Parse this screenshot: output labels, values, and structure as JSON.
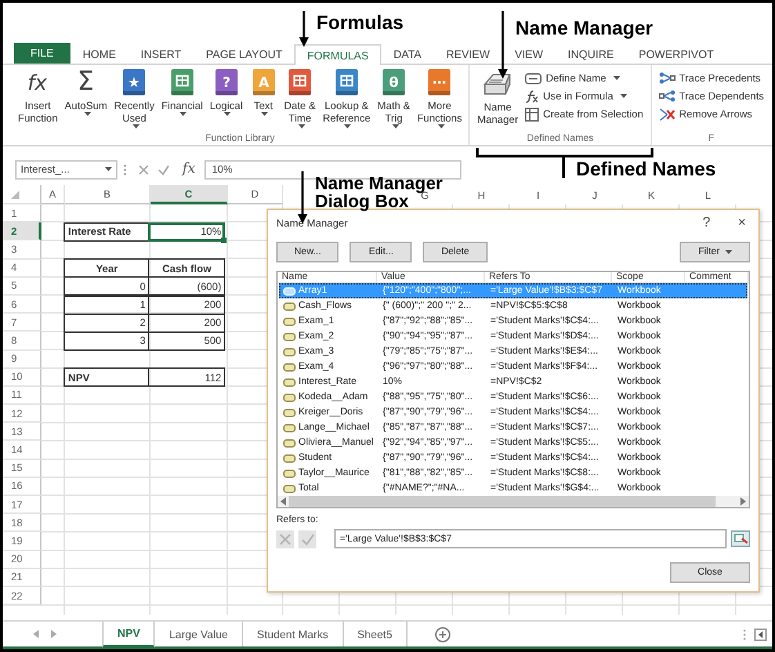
{
  "callouts": [
    {
      "lines": [
        "Formulas"
      ]
    },
    {
      "lines": [
        "Name Manager"
      ]
    },
    {
      "lines": [
        "Name Manager",
        "Dialog Box"
      ]
    },
    {
      "lines": [
        "Defined Names"
      ]
    }
  ],
  "ribbon": {
    "file_tab": "FILE",
    "tabs": [
      {
        "label": "HOME",
        "selected": false
      },
      {
        "label": "INSERT",
        "selected": false
      },
      {
        "label": "PAGE LAYOUT",
        "selected": false
      },
      {
        "label": "FORMULAS",
        "selected": true
      },
      {
        "label": "DATA",
        "selected": false
      },
      {
        "label": "REVIEW",
        "selected": false
      },
      {
        "label": "VIEW",
        "selected": false
      },
      {
        "label": "INQUIRE",
        "selected": false
      },
      {
        "label": "POWERPIVOT",
        "selected": false
      }
    ],
    "function_library": {
      "label": "Function Library",
      "buttons": [
        {
          "kind": "symbol",
          "glyph": "fx",
          "lines": [
            "Insert",
            "Function"
          ],
          "dropdown": false
        },
        {
          "kind": "symbol",
          "glyph": "Σ",
          "lines": [
            "AutoSum"
          ],
          "dropdown": true
        },
        {
          "kind": "book",
          "color": "#3b77c6",
          "glyph": "★",
          "lines": [
            "Recently",
            "Used"
          ],
          "dropdown": true
        },
        {
          "kind": "book",
          "color": "#4a9e6a",
          "lines": [
            "Financial"
          ],
          "dropdown": true
        },
        {
          "kind": "book",
          "color": "#8b5ec2",
          "glyph": "?",
          "lines": [
            "Logical"
          ],
          "dropdown": true
        },
        {
          "kind": "book",
          "color": "#f0a53c",
          "glyph": "A",
          "lines": [
            "Text"
          ],
          "dropdown": true
        },
        {
          "kind": "book",
          "color": "#df5a3e",
          "lines": [
            "Date &",
            "Time"
          ],
          "dropdown": true
        },
        {
          "kind": "book",
          "color": "#3b86c6",
          "lines": [
            "Lookup &",
            "Reference"
          ],
          "dropdown": true
        },
        {
          "kind": "book",
          "color": "#4a9e7a",
          "glyph": "θ",
          "lines": [
            "Math &",
            "Trig"
          ],
          "dropdown": true
        },
        {
          "kind": "book",
          "color": "#e8782c",
          "glyph": "⋯",
          "lines": [
            "More",
            "Functions"
          ],
          "dropdown": true
        }
      ]
    },
    "defined_names": {
      "label": "Defined Names",
      "main": {
        "lines": [
          "Name",
          "Manager"
        ]
      },
      "items": [
        {
          "kind": "tag",
          "label": "Define Name",
          "dropdown": true
        },
        {
          "kind": "formula",
          "label": "Use in Formula",
          "dropdown": true
        },
        {
          "kind": "grid",
          "label": "Create from Selection",
          "dropdown": false
        }
      ]
    },
    "formula_auditing": {
      "label": "F",
      "items": [
        {
          "kind": "precedents",
          "label": "Trace Precedents"
        },
        {
          "kind": "dependents",
          "label": "Trace Dependents"
        },
        {
          "kind": "remove",
          "label": "Remove Arrows"
        }
      ]
    }
  },
  "formula_bar": {
    "name_box": "Interest_...",
    "function_symbol": "fx",
    "value": "10%"
  },
  "sheet": {
    "column_headers": [
      "A",
      "B",
      "C",
      "D"
    ],
    "more_column_headers": [
      "G",
      "H",
      "I",
      "J",
      "K",
      "L"
    ],
    "rows": [
      {
        "number": "1"
      },
      {
        "number": "2",
        "cells": [
          {
            "kind": "blank"
          },
          {
            "kind": "label",
            "text": "Interest Rate",
            "selected": false
          },
          {
            "kind": "number",
            "text": "10%",
            "selected": true
          }
        ]
      },
      {
        "number": "3"
      },
      {
        "number": "4",
        "cells": [
          {
            "kind": "blank"
          },
          {
            "kind": "heading",
            "text": "Year",
            "selected": false
          },
          {
            "kind": "heading",
            "text": "Cash flow",
            "selected": false
          }
        ]
      },
      {
        "number": "5",
        "cells": [
          {
            "kind": "blank"
          },
          {
            "kind": "number",
            "text": "0",
            "selected": false
          },
          {
            "kind": "number",
            "text": "(600)",
            "selected": false
          }
        ]
      },
      {
        "number": "6",
        "cells": [
          {
            "kind": "blank"
          },
          {
            "kind": "number",
            "text": "1",
            "selected": false
          },
          {
            "kind": "number",
            "text": "200",
            "selected": false
          }
        ]
      },
      {
        "number": "7",
        "cells": [
          {
            "kind": "blank"
          },
          {
            "kind": "number",
            "text": "2",
            "selected": false
          },
          {
            "kind": "number",
            "text": "200",
            "selected": false
          }
        ]
      },
      {
        "number": "8",
        "cells": [
          {
            "kind": "blank"
          },
          {
            "kind": "number",
            "text": "3",
            "selected": false
          },
          {
            "kind": "number",
            "text": "500",
            "selected": false
          }
        ]
      },
      {
        "number": "9"
      },
      {
        "number": "10",
        "cells": [
          {
            "kind": "blank"
          },
          {
            "kind": "label",
            "text": "NPV",
            "selected": false
          },
          {
            "kind": "number",
            "text": "112",
            "selected": false
          }
        ]
      },
      {
        "number": "11"
      },
      {
        "number": "12"
      },
      {
        "number": "13"
      },
      {
        "number": "14"
      },
      {
        "number": "15"
      },
      {
        "number": "16"
      },
      {
        "number": "17"
      },
      {
        "number": "18"
      },
      {
        "number": "19"
      },
      {
        "number": "20"
      },
      {
        "number": "21"
      },
      {
        "number": "22"
      }
    ]
  },
  "dialog": {
    "title": "Name Manager",
    "help": "?",
    "close": "×",
    "buttons": [
      {
        "label": "New...",
        "dropdown": false
      },
      {
        "label": "Edit...",
        "dropdown": false
      },
      {
        "label": "Delete",
        "dropdown": false
      },
      {
        "label": "Filter",
        "dropdown": true
      }
    ],
    "columns": [
      "Name",
      "Value",
      "Refers To",
      "Scope",
      "Comment"
    ],
    "rows": [
      {
        "name": "Array1",
        "value": "{\"120\";\"400\";\"800\";...",
        "refers_to": "='Large Value'!$B$3:$C$7",
        "scope": "Workbook",
        "selected": true
      },
      {
        "name": "Cash_Flows",
        "value": "{\" (600)\";\" 200 \";\" 2...",
        "refers_to": "=NPV!$C$5:$C$8",
        "scope": "Workbook",
        "selected": false
      },
      {
        "name": "Exam_1",
        "value": "{\"87\";\"92\";\"88\";\"85\"...",
        "refers_to": "='Student Marks'!$C$4:...",
        "scope": "Workbook",
        "selected": false
      },
      {
        "name": "Exam_2",
        "value": "{\"90\";\"94\";\"95\";\"87\"...",
        "refers_to": "='Student Marks'!$D$4:...",
        "scope": "Workbook",
        "selected": false
      },
      {
        "name": "Exam_3",
        "value": "{\"79\";\"85\";\"75\";\"87\"...",
        "refers_to": "='Student Marks'!$E$4:...",
        "scope": "Workbook",
        "selected": false
      },
      {
        "name": "Exam_4",
        "value": "{\"96\";\"97\";\"80\";\"88\"...",
        "refers_to": "='Student Marks'!$F$4:...",
        "scope": "Workbook",
        "selected": false
      },
      {
        "name": "Interest_Rate",
        "value": "10%",
        "refers_to": "=NPV!$C$2",
        "scope": "Workbook",
        "selected": false
      },
      {
        "name": "Kodeda__Adam",
        "value": "{\"88\",\"95\",\"75\",\"80\"...",
        "refers_to": "='Student Marks'!$C$6:...",
        "scope": "Workbook",
        "selected": false
      },
      {
        "name": "Kreiger__Doris",
        "value": "{\"87\",\"90\",\"79\",\"96\"...",
        "refers_to": "='Student Marks'!$C$4:...",
        "scope": "Workbook",
        "selected": false
      },
      {
        "name": "Lange__Michael",
        "value": "{\"85\",\"87\",\"87\",\"88\"...",
        "refers_to": "='Student Marks'!$C$7:...",
        "scope": "Workbook",
        "selected": false
      },
      {
        "name": "Oliviera__Manuel",
        "value": "{\"92\",\"94\",\"85\",\"97\"...",
        "refers_to": "='Student Marks'!$C$5:...",
        "scope": "Workbook",
        "selected": false
      },
      {
        "name": "Student",
        "value": "{\"87\",\"90\",\"79\",\"96\"...",
        "refers_to": "='Student Marks'!$C$4:...",
        "scope": "Workbook",
        "selected": false
      },
      {
        "name": "Taylor__Maurice",
        "value": "{\"81\",\"88\",\"82\",\"85\"...",
        "refers_to": "='Student Marks'!$C$8:...",
        "scope": "Workbook",
        "selected": false
      },
      {
        "name": "Total",
        "value": "{\"#NAME?\";\"#NA...",
        "refers_to": "='Student Marks'!$G$4:...",
        "scope": "Workbook",
        "selected": false
      }
    ],
    "refers_label": "Refers to:",
    "refers_value": "='Large Value'!$B$3:$C$7",
    "close_button": "Close"
  },
  "sheet_tabs": [
    {
      "label": "NPV",
      "selected": true
    },
    {
      "label": "Large Value",
      "selected": false
    },
    {
      "label": "Student Marks",
      "selected": false
    },
    {
      "label": "Sheet5",
      "selected": false
    }
  ]
}
